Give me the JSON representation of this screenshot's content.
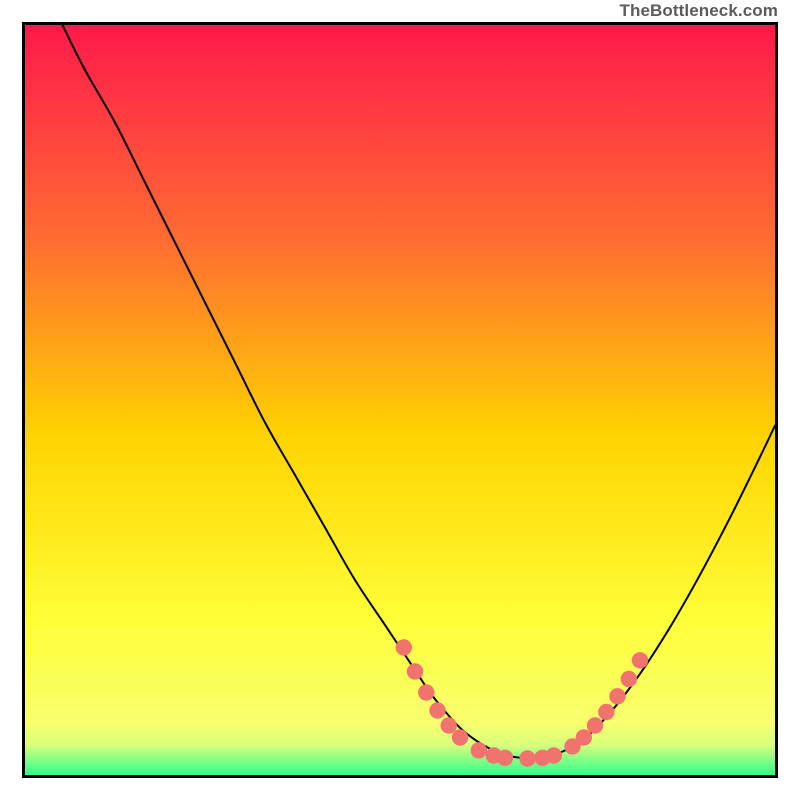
{
  "credit": {
    "text": "TheBottleneck.com"
  },
  "colors": {
    "gradient_top": "#ff1a4b",
    "gradient_mid1": "#ff6a33",
    "gradient_mid2": "#ffd400",
    "gradient_mid3": "#ffff3a",
    "gradient_bottom_yellow": "#f7ff6e",
    "gradient_green": "#2dff8e",
    "curve": "#000000",
    "marker_fill": "#f0736e",
    "marker_stroke": "#e45c57"
  },
  "chart_data": {
    "type": "line",
    "title": "",
    "xlabel": "",
    "ylabel": "",
    "xlim": [
      0,
      100
    ],
    "ylim": [
      0,
      100
    ],
    "series": [
      {
        "name": "bottleneck-curve",
        "x": [
          5,
          8,
          12,
          16,
          20,
          24,
          28,
          32,
          36,
          40,
          44,
          48,
          52,
          54,
          56,
          58,
          60,
          62,
          64,
          66,
          68,
          70,
          74,
          78,
          82,
          86,
          90,
          94,
          98,
          100
        ],
        "y": [
          100,
          94,
          87,
          79,
          71,
          63,
          55,
          47,
          40,
          33,
          26,
          20,
          14,
          11,
          8.5,
          6.3,
          4.7,
          3.5,
          2.7,
          2.3,
          2.2,
          2.5,
          4.4,
          8.3,
          13.5,
          19.7,
          26.7,
          34.3,
          42.4,
          46.6
        ]
      }
    ],
    "markers": [
      {
        "x": 50.5,
        "y": 17.0
      },
      {
        "x": 52.0,
        "y": 13.8
      },
      {
        "x": 53.5,
        "y": 11.0
      },
      {
        "x": 55.0,
        "y": 8.6
      },
      {
        "x": 56.5,
        "y": 6.6
      },
      {
        "x": 58.0,
        "y": 5.0
      },
      {
        "x": 60.5,
        "y": 3.3
      },
      {
        "x": 62.5,
        "y": 2.6
      },
      {
        "x": 64.0,
        "y": 2.3
      },
      {
        "x": 67.0,
        "y": 2.2
      },
      {
        "x": 69.0,
        "y": 2.3
      },
      {
        "x": 70.5,
        "y": 2.6
      },
      {
        "x": 73.0,
        "y": 3.8
      },
      {
        "x": 74.5,
        "y": 5.0
      },
      {
        "x": 76.0,
        "y": 6.6
      },
      {
        "x": 77.5,
        "y": 8.4
      },
      {
        "x": 79.0,
        "y": 10.5
      },
      {
        "x": 80.5,
        "y": 12.8
      },
      {
        "x": 82.0,
        "y": 15.3
      }
    ]
  }
}
